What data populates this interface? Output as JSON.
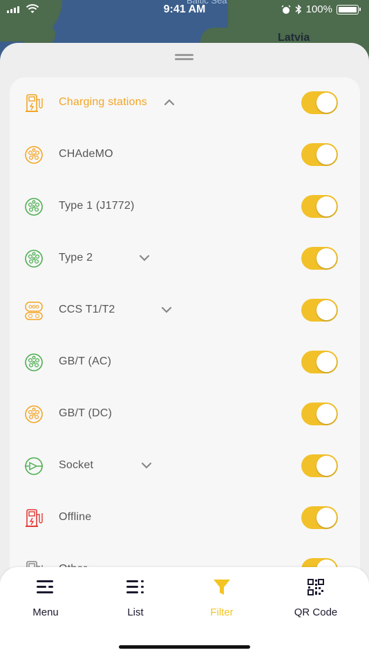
{
  "status_bar": {
    "time": "9:41 AM",
    "battery": "100%"
  },
  "map": {
    "sea_label": "Baltic Sea",
    "country_label": "Latvia"
  },
  "filters": [
    {
      "label": "Charging stations",
      "active": true,
      "expandable": true,
      "expanded": true,
      "icon": "charging-station-icon",
      "color": "#f3a525",
      "enabled": true
    },
    {
      "label": "CHAdeMO",
      "icon": "chademo-connector-icon",
      "color": "#f3a525",
      "enabled": true
    },
    {
      "label": "Type 1 (J1772)",
      "icon": "type1-connector-icon",
      "color": "#4caf50",
      "enabled": true
    },
    {
      "label": "Type 2",
      "expandable": true,
      "icon": "type2-connector-icon",
      "color": "#4caf50",
      "enabled": true
    },
    {
      "label": "CCS T1/T2",
      "expandable": true,
      "icon": "ccs-connector-icon",
      "color": "#f3a525",
      "enabled": true
    },
    {
      "label": "GB/T (AC)",
      "icon": "gbt-ac-connector-icon",
      "color": "#4caf50",
      "enabled": true
    },
    {
      "label": "GB/T (DC)",
      "icon": "gbt-dc-connector-icon",
      "color": "#f3a525",
      "enabled": true
    },
    {
      "label": "Socket",
      "expandable": true,
      "icon": "socket-icon",
      "color": "#4caf50",
      "enabled": true
    },
    {
      "label": "Offline",
      "icon": "offline-station-icon",
      "color": "#e53935",
      "enabled": true
    },
    {
      "label": "Other",
      "icon": "other-station-icon",
      "color": "#888888",
      "enabled": true
    }
  ],
  "tabs": [
    {
      "label": "Menu",
      "icon": "menu-icon"
    },
    {
      "label": "List",
      "icon": "list-icon"
    },
    {
      "label": "Filter",
      "icon": "filter-icon",
      "active": true
    },
    {
      "label": "QR Code",
      "icon": "qr-code-icon"
    }
  ],
  "colors": {
    "accent": "#f3c423",
    "toggle_on": "#f2c12a",
    "active_label": "#f3a525"
  }
}
